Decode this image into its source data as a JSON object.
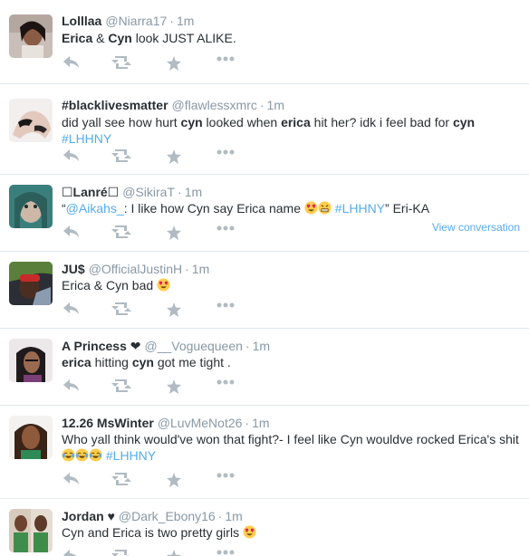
{
  "colors": {
    "link": "#55acee",
    "meta": "#8899a6",
    "action": "#b1bbc3",
    "divider": "#e1e8ed"
  },
  "icons": {
    "reply": "reply-icon",
    "retweet": "retweet-icon",
    "favorite": "star-icon",
    "more": "more-icon"
  },
  "tweets": [
    {
      "fullname": "Lolllaa",
      "username": "@Niarra17",
      "dot": "·",
      "time": "1m",
      "parts": [
        {
          "t": "Erica",
          "b": true
        },
        {
          "t": " & "
        },
        {
          "t": "Cyn",
          "b": true
        },
        {
          "t": " look JUST ALIKE."
        }
      ]
    },
    {
      "fullname": "#blacklivesmatter",
      "username": "@flawlessxmrc",
      "dot": "·",
      "time": "1m",
      "parts": [
        {
          "t": "did yall see how hurt "
        },
        {
          "t": "cyn",
          "b": true
        },
        {
          "t": " looked when "
        },
        {
          "t": "erica",
          "b": true
        },
        {
          "t": " hit her? idk i feel bad for "
        },
        {
          "t": "cyn",
          "b": true
        },
        {
          "t": " "
        },
        {
          "t": "#LHHNY",
          "link": true
        }
      ]
    },
    {
      "fullname": "☐Lanré☐",
      "username": "@SikiraT",
      "dot": "·",
      "time": "1m",
      "parts": [
        {
          "t": "“"
        },
        {
          "t": "@Aikahs_",
          "link": true
        },
        {
          "t": ": I like how Cyn say Erica name "
        },
        {
          "emoji": "heart-eyes"
        },
        {
          "emoji": "grimace"
        },
        {
          "t": " "
        },
        {
          "t": "#LHHNY",
          "link": true
        },
        {
          "t": "” Eri-KA"
        }
      ],
      "view_conversation": "View conversation"
    },
    {
      "fullname": "JU$",
      "username": "@OfficialJustinH",
      "dot": "·",
      "time": "1m",
      "parts": [
        {
          "t": "Erica & Cyn bad "
        },
        {
          "emoji": "heart-eyes"
        }
      ]
    },
    {
      "fullname": "A Princess ❤",
      "username": "@__Voguequeen",
      "dot": "·",
      "time": "1m",
      "parts": [
        {
          "t": "erica",
          "b": true
        },
        {
          "t": " hitting "
        },
        {
          "t": "cyn",
          "b": true
        },
        {
          "t": " got me tight ."
        }
      ]
    },
    {
      "fullname": "12.26 MsWinter",
      "username": "@LuvMeNot26",
      "dot": "·",
      "time": "1m",
      "parts": [
        {
          "t": "Who yall think would've won that fight?- I feel like Cyn wouldve rocked Erica's shit "
        },
        {
          "emoji": "joy"
        },
        {
          "emoji": "joy"
        },
        {
          "emoji": "joy"
        },
        {
          "t": " "
        },
        {
          "t": "#LHHNY",
          "link": true
        }
      ]
    },
    {
      "fullname": "Jordan ♥",
      "username": "@Dark_Ebony16",
      "dot": "·",
      "time": "1m",
      "parts": [
        {
          "t": "Cyn and Erica is two pretty girls "
        },
        {
          "emoji": "heart-eyes"
        }
      ]
    }
  ]
}
